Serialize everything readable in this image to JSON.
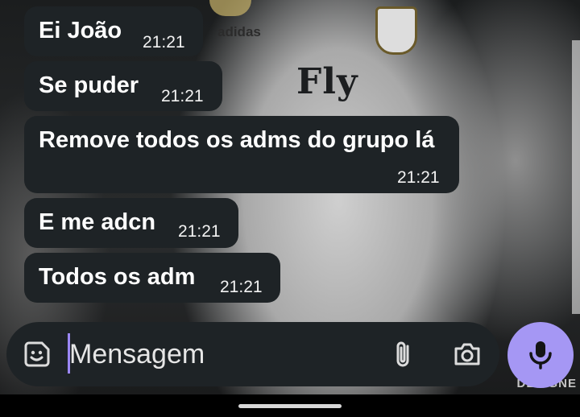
{
  "wallpaper": {
    "brand": "adidas",
    "jersey_text": "Fly",
    "watermark": "DESIGNE"
  },
  "messages": [
    {
      "text": "Ei João",
      "time": "21:21"
    },
    {
      "text": "Se puder",
      "time": "21:21"
    },
    {
      "text": "Remove todos os adms do grupo lá",
      "time": "21:21"
    },
    {
      "text": "E me adcn",
      "time": "21:21"
    },
    {
      "text": "Todos os adm",
      "time": "21:21"
    }
  ],
  "composer": {
    "placeholder": "Mensagem",
    "sticker_icon": "sticker-icon",
    "attach_icon": "paperclip-icon",
    "camera_icon": "camera-icon",
    "mic_icon": "microphone-icon"
  },
  "colors": {
    "bubble": "#1e2326",
    "accent": "#a597f4",
    "cursor": "#9b87f5"
  }
}
